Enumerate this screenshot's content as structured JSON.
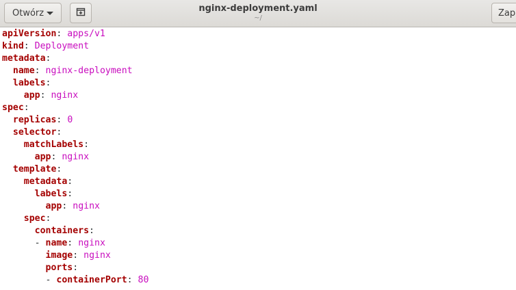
{
  "header": {
    "open_label": "Otwórz",
    "new_tab_icon": "new-document-icon",
    "title": "nginx-deployment.yaml",
    "subtitle": "~/",
    "save_label": "Zapisz"
  },
  "editor": {
    "lines": [
      {
        "indent": "",
        "dash": "",
        "key": "apiVersion",
        "value": "apps/v1"
      },
      {
        "indent": "",
        "dash": "",
        "key": "kind",
        "value": "Deployment"
      },
      {
        "indent": "",
        "dash": "",
        "key": "metadata",
        "value": ""
      },
      {
        "indent": "  ",
        "dash": "",
        "key": "name",
        "value": "nginx-deployment"
      },
      {
        "indent": "  ",
        "dash": "",
        "key": "labels",
        "value": ""
      },
      {
        "indent": "    ",
        "dash": "",
        "key": "app",
        "value": "nginx"
      },
      {
        "indent": "",
        "dash": "",
        "key": "spec",
        "value": ""
      },
      {
        "indent": "  ",
        "dash": "",
        "key": "replicas",
        "value": "0"
      },
      {
        "indent": "  ",
        "dash": "",
        "key": "selector",
        "value": ""
      },
      {
        "indent": "    ",
        "dash": "",
        "key": "matchLabels",
        "value": ""
      },
      {
        "indent": "      ",
        "dash": "",
        "key": "app",
        "value": "nginx"
      },
      {
        "indent": "  ",
        "dash": "",
        "key": "template",
        "value": ""
      },
      {
        "indent": "    ",
        "dash": "",
        "key": "metadata",
        "value": ""
      },
      {
        "indent": "      ",
        "dash": "",
        "key": "labels",
        "value": ""
      },
      {
        "indent": "        ",
        "dash": "",
        "key": "app",
        "value": "nginx"
      },
      {
        "indent": "    ",
        "dash": "",
        "key": "spec",
        "value": ""
      },
      {
        "indent": "      ",
        "dash": "",
        "key": "containers",
        "value": ""
      },
      {
        "indent": "      ",
        "dash": "- ",
        "key": "name",
        "value": "nginx"
      },
      {
        "indent": "        ",
        "dash": "",
        "key": "image",
        "value": "nginx"
      },
      {
        "indent": "        ",
        "dash": "",
        "key": "ports",
        "value": ""
      },
      {
        "indent": "        ",
        "dash": "- ",
        "key": "containerPort",
        "value": "80"
      }
    ]
  },
  "colors": {
    "key": "#a40000",
    "value": "#c80cbe",
    "headerbar": "#dcdad6"
  }
}
